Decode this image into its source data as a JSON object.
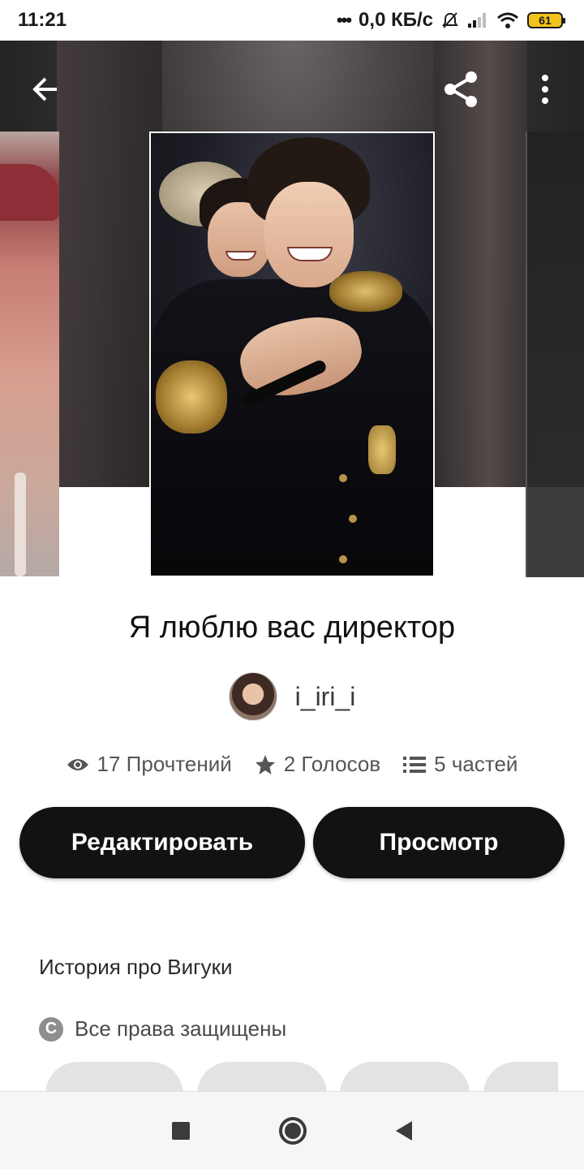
{
  "status_bar": {
    "time": "11:21",
    "network_speed": "0,0 КБ/с",
    "battery": "61",
    "icons": [
      "mute-bell-icon",
      "signal-icon",
      "wifi-icon",
      "battery-icon"
    ]
  },
  "header": {
    "back_icon": "arrow-left-icon",
    "share_icon": "share-icon",
    "menu_icon": "more-vertical-icon"
  },
  "story": {
    "title": "Я люблю вас директор",
    "author": "i_iri_i",
    "reads": "17 Прочтений",
    "votes": "2 Голосов",
    "parts": "5 частей",
    "description": "История про Вигуки",
    "rights": "Все права защищены"
  },
  "actions": {
    "edit_label": "Редактировать",
    "view_label": "Просмотр"
  },
  "colors": {
    "button_bg": "#121212",
    "button_text": "#ffffff",
    "tag_bg": "#e3e3e5"
  },
  "nav": {
    "icons": [
      "recents-icon",
      "home-icon",
      "back-icon"
    ]
  }
}
